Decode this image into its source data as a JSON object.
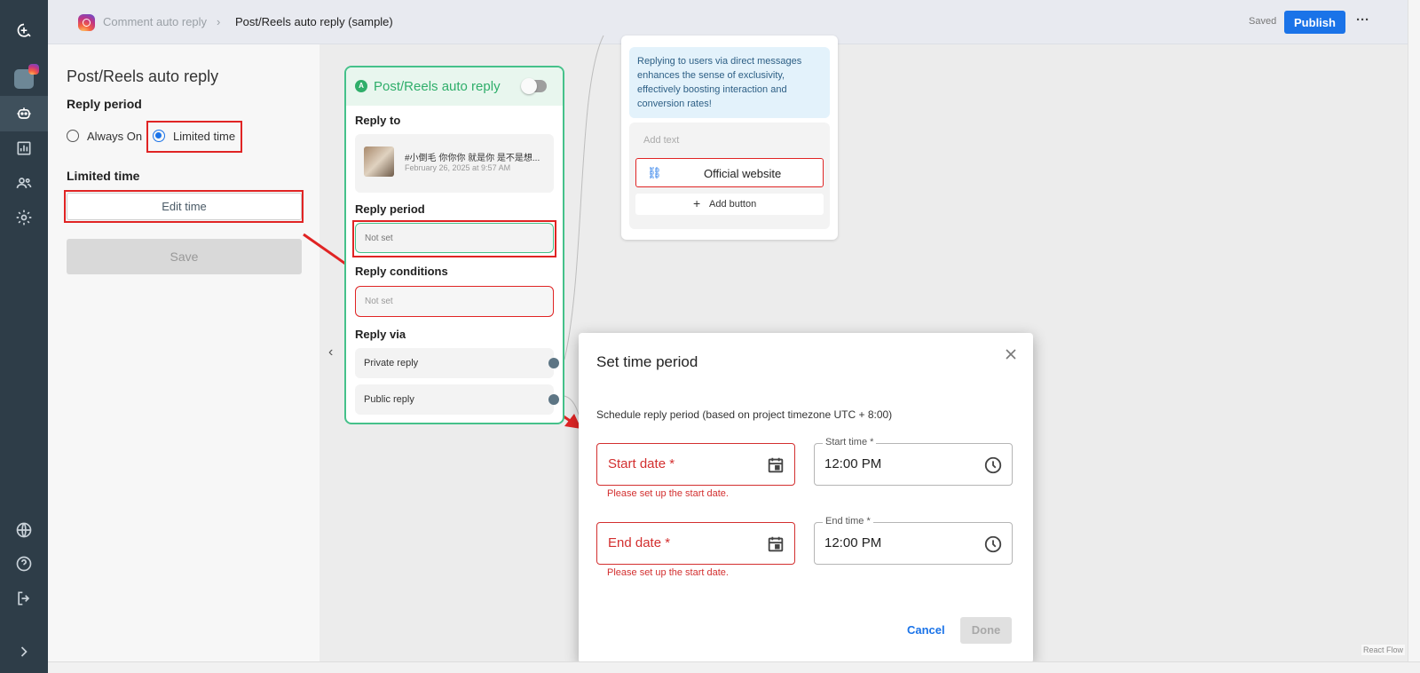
{
  "topbar": {
    "breadcrumb_parent": "Comment auto reply",
    "breadcrumb_current": "Post/Reels auto reply (sample)",
    "saved_label": "Saved",
    "publish_label": "Publish",
    "more_label": "···"
  },
  "panel": {
    "title": "Post/Reels auto reply",
    "reply_period_heading": "Reply period",
    "option_always_on": "Always On",
    "option_limited_time": "Limited time",
    "selected_option": "Limited time",
    "limited_time_heading": "Limited time",
    "edit_time_label": "Edit time",
    "save_label": "Save"
  },
  "flow_card": {
    "title": "Post/Reels auto reply",
    "reply_to_heading": "Reply to",
    "post_caption": "#小倒毛 你你你 就是你 是不是想...",
    "post_date": "February 26, 2025 at 9:57 AM",
    "reply_period_heading": "Reply period",
    "reply_period_value": "Not set",
    "reply_conditions_heading": "Reply conditions",
    "reply_conditions_value": "Not set",
    "reply_via_heading": "Reply via",
    "private_reply": "Private reply",
    "public_reply": "Public reply"
  },
  "message_card": {
    "info_text": "Replying to users via direct messages enhances the sense of exclusivity, effectively boosting interaction and conversion rates!",
    "add_text_placeholder": "Add text",
    "official_website_label": "Official website",
    "add_button_label": "Add button"
  },
  "dialog": {
    "title": "Set time period",
    "description": "Schedule reply period (based on project timezone UTC + 8:00)",
    "start_date_label": "Start date *",
    "start_date_error": "Please set up the start date.",
    "start_time_label": "Start time *",
    "start_time_value": "12:00 PM",
    "end_date_label": "End date *",
    "end_date_error": "Please set up the start date.",
    "end_time_label": "End time *",
    "end_time_value": "12:00 PM",
    "cancel_label": "Cancel",
    "done_label": "Done"
  },
  "react_flow_label": "React Flow",
  "colors": {
    "primary": "#1a73e8",
    "error": "#d32f2f",
    "annotation": "#e02424",
    "flow_green": "#45c18a",
    "rail": "#2e3d48"
  }
}
